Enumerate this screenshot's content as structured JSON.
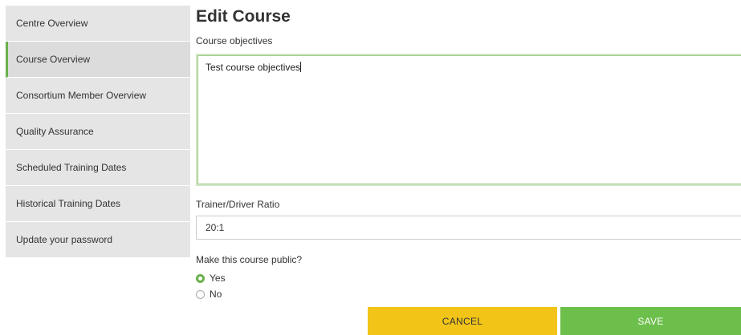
{
  "sidebar": {
    "items": [
      {
        "label": "Centre Overview"
      },
      {
        "label": "Course Overview"
      },
      {
        "label": "Consortium Member Overview"
      },
      {
        "label": "Quality Assurance"
      },
      {
        "label": "Scheduled Training Dates"
      },
      {
        "label": "Historical Training Dates"
      },
      {
        "label": "Update your password"
      }
    ],
    "active_item": "Course Overview"
  },
  "main": {
    "title": "Edit Course",
    "objectives": {
      "label": "Course objectives",
      "value": "Test course objectives"
    },
    "ratio": {
      "label": "Trainer/Driver Ratio",
      "value": "20:1"
    },
    "public": {
      "label": "Make this course public?",
      "options": [
        {
          "label": "Yes",
          "selected": true
        },
        {
          "label": "No",
          "selected": false
        }
      ]
    }
  },
  "actions": {
    "cancel_label": "CANCEL",
    "save_label": "SAVE"
  },
  "colors": {
    "accent_green": "#6cbf4b",
    "cancel_yellow": "#f2c418",
    "sidebar_bg": "#e5e5e5"
  }
}
